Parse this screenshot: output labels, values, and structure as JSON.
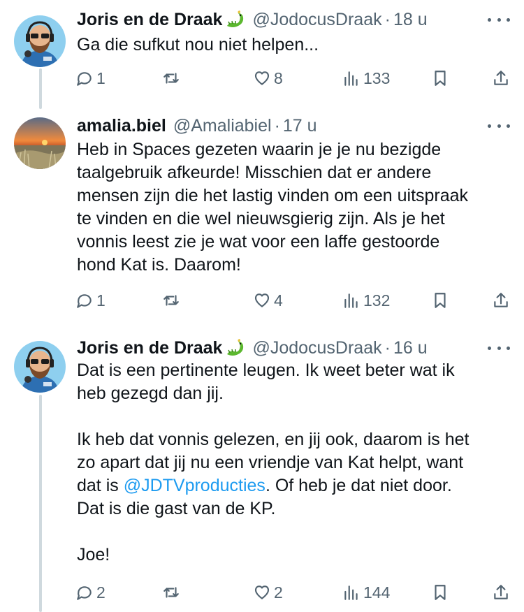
{
  "tweets": [
    {
      "name": "Joris en de Draak",
      "handle": "@JodocusDraak",
      "dot": "·",
      "time": "18 u",
      "body": [
        "Ga die sufkut nou niet helpen..."
      ],
      "replies": "1",
      "retweets": "",
      "likes": "8",
      "views": "133"
    },
    {
      "name": "amalia.biel",
      "handle": "@Amaliabiel",
      "dot": "·",
      "time": "17 u",
      "body": [
        "Heb in Spaces gezeten waarin je je nu bezigde",
        "taalgebruik afkeurde! Misschien dat er andere",
        "mensen zijn die het lastig vinden om een uitspraak",
        "te vinden en die wel nieuwsgierig zijn. Als je het",
        "vonnis leest zie je wat voor een laffe gestoorde",
        "hond Kat is. Daarom!"
      ],
      "replies": "1",
      "retweets": "",
      "likes": "4",
      "views": "132"
    },
    {
      "name": "Joris en de Draak",
      "handle": "@JodocusDraak",
      "dot": "·",
      "time": "16 u",
      "body": [
        "Dat is een pertinente leugen. Ik weet beter wat ik",
        "heb gezegd dan jij.",
        "",
        "Ik heb dat vonnis gelezen, en jij ook, daarom is het",
        "zo apart dat jij nu een  vriendje van Kat helpt, want"
      ],
      "body_link_line": {
        "before": "dat is ",
        "link": "@JDTVproducties",
        "after": ". Of heb je dat niet door."
      },
      "body_tail": [
        "Dat is die gast van de KP.",
        "",
        "Joe!"
      ],
      "replies": "2",
      "retweets": "",
      "likes": "2",
      "views": "144"
    }
  ],
  "colors": {
    "text": "#0f1419",
    "secondary": "#536471",
    "link": "#1d9bf0",
    "thread": "#cfd9de"
  }
}
